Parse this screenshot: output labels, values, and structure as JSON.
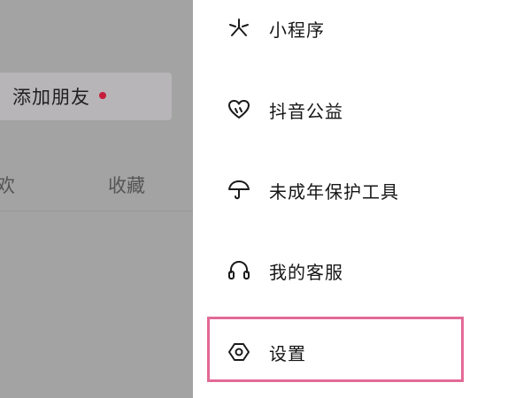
{
  "background_profile": {
    "add_friend_label": "添加朋友",
    "tabs": [
      {
        "label": "欢"
      },
      {
        "label": "收藏"
      }
    ]
  },
  "drawer_menu": {
    "items": [
      {
        "label": "小程序",
        "icon": "mini-program-icon"
      },
      {
        "label": "抖音公益",
        "icon": "charity-heart-icon"
      },
      {
        "label": "未成年保护工具",
        "icon": "umbrella-icon"
      },
      {
        "label": "我的客服",
        "icon": "headset-icon"
      },
      {
        "label": "设置",
        "icon": "settings-hexagon-icon"
      }
    ],
    "highlighted_item": "设置"
  },
  "colors": {
    "highlight_border": "#e26a96",
    "notification_dot": "#c61d3b",
    "overlay": "#a3a3a3",
    "drawer_bg": "#ffffff"
  }
}
